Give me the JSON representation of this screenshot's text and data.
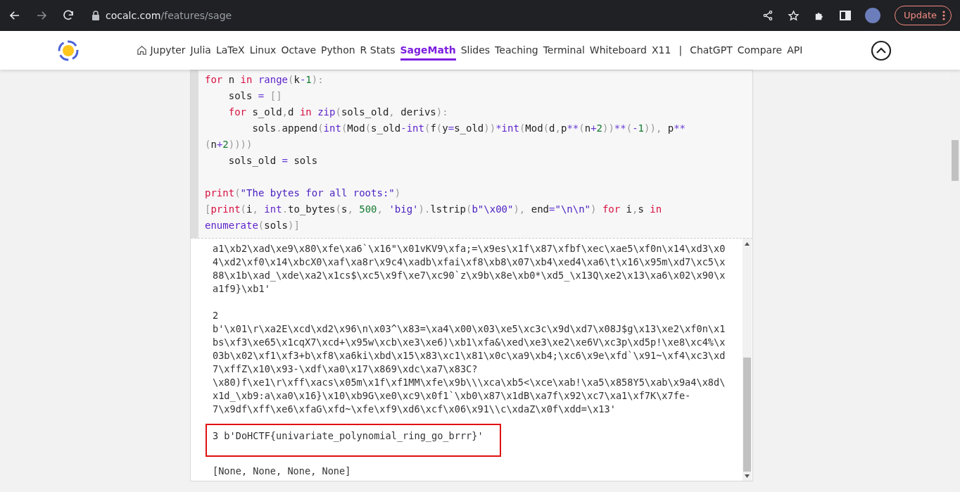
{
  "browser": {
    "url_host": "cocalc.com",
    "url_path": "/features/sage",
    "update_button": "Update"
  },
  "nav": {
    "items": [
      {
        "label": "Jupyter",
        "selected": false,
        "home_icon": true
      },
      {
        "label": "Julia",
        "selected": false
      },
      {
        "label": "LaTeX",
        "selected": false
      },
      {
        "label": "Linux",
        "selected": false
      },
      {
        "label": "Octave",
        "selected": false
      },
      {
        "label": "Python",
        "selected": false
      },
      {
        "label": "R Stats",
        "selected": false
      },
      {
        "label": "SageMath",
        "selected": true
      },
      {
        "label": "Slides",
        "selected": false
      },
      {
        "label": "Teaching",
        "selected": false
      },
      {
        "label": "Terminal",
        "selected": false
      },
      {
        "label": "Whiteboard",
        "selected": false
      },
      {
        "label": "X11",
        "selected": false
      },
      {
        "label": "|",
        "kind": "separator"
      },
      {
        "label": "ChatGPT",
        "selected": false
      },
      {
        "label": "Compare",
        "selected": false
      },
      {
        "label": "API",
        "selected": false
      }
    ]
  },
  "code": {
    "lines": [
      {
        "tokens": [
          {
            "text": "for",
            "kind": "kw"
          },
          {
            "text": " n ",
            "kind": "plain"
          },
          {
            "text": "in ",
            "kind": "kw"
          },
          {
            "text": "range",
            "kind": "builtin"
          },
          {
            "text": "(",
            "kind": "punct"
          },
          {
            "text": "k",
            "kind": "plain"
          },
          {
            "text": "-",
            "kind": "op"
          },
          {
            "text": "1",
            "kind": "num"
          },
          {
            "text": "):",
            "kind": "punct"
          }
        ]
      },
      {
        "tokens": [
          {
            "text": "    sols ",
            "kind": "plain"
          },
          {
            "text": "= ",
            "kind": "op"
          },
          {
            "text": "[]",
            "kind": "punct"
          }
        ]
      },
      {
        "tokens": [
          {
            "text": "    for",
            "kind": "kw"
          },
          {
            "text": " s_old",
            "kind": "plain"
          },
          {
            "text": ",",
            "kind": "punct"
          },
          {
            "text": "d ",
            "kind": "plain"
          },
          {
            "text": "in ",
            "kind": "kw"
          },
          {
            "text": "zip",
            "kind": "builtin"
          },
          {
            "text": "(",
            "kind": "punct"
          },
          {
            "text": "sols_old",
            "kind": "plain"
          },
          {
            "text": ",",
            "kind": "punct"
          },
          {
            "text": " derivs",
            "kind": "plain"
          },
          {
            "text": "):",
            "kind": "punct"
          }
        ]
      },
      {
        "tokens": [
          {
            "text": "        sols",
            "kind": "plain"
          },
          {
            "text": ".",
            "kind": "punct"
          },
          {
            "text": "append",
            "kind": "plain"
          },
          {
            "text": "(",
            "kind": "punct"
          },
          {
            "text": "int",
            "kind": "builtin"
          },
          {
            "text": "(",
            "kind": "punct"
          },
          {
            "text": "Mod",
            "kind": "plain"
          },
          {
            "text": "(",
            "kind": "punct"
          },
          {
            "text": "s_old",
            "kind": "plain"
          },
          {
            "text": "-",
            "kind": "op"
          },
          {
            "text": "int",
            "kind": "builtin"
          },
          {
            "text": "(",
            "kind": "punct"
          },
          {
            "text": "f",
            "kind": "plain"
          },
          {
            "text": "(",
            "kind": "punct"
          },
          {
            "text": "y",
            "kind": "plain"
          },
          {
            "text": "=",
            "kind": "op"
          },
          {
            "text": "s_old",
            "kind": "plain"
          },
          {
            "text": "))",
            "kind": "punct"
          },
          {
            "text": "*",
            "kind": "op"
          },
          {
            "text": "int",
            "kind": "builtin"
          },
          {
            "text": "(",
            "kind": "punct"
          },
          {
            "text": "Mod",
            "kind": "plain"
          },
          {
            "text": "(",
            "kind": "punct"
          },
          {
            "text": "d",
            "kind": "plain"
          },
          {
            "text": ",",
            "kind": "punct"
          },
          {
            "text": "p",
            "kind": "plain"
          },
          {
            "text": "**",
            "kind": "op"
          },
          {
            "text": "(",
            "kind": "punct"
          },
          {
            "text": "n",
            "kind": "plain"
          },
          {
            "text": "+",
            "kind": "op"
          },
          {
            "text": "2",
            "kind": "num"
          },
          {
            "text": "))",
            "kind": "punct"
          },
          {
            "text": "**",
            "kind": "op"
          },
          {
            "text": "(",
            "kind": "punct"
          },
          {
            "text": "-",
            "kind": "op"
          },
          {
            "text": "1",
            "kind": "num"
          },
          {
            "text": ")),",
            "kind": "punct"
          },
          {
            "text": " p",
            "kind": "plain"
          },
          {
            "text": "**",
            "kind": "op"
          }
        ]
      },
      {
        "tokens": [
          {
            "text": "(",
            "kind": "punct"
          },
          {
            "text": "n",
            "kind": "plain"
          },
          {
            "text": "+",
            "kind": "op"
          },
          {
            "text": "2",
            "kind": "num"
          },
          {
            "text": "))))",
            "kind": "punct"
          }
        ]
      },
      {
        "tokens": [
          {
            "text": "    sols_old ",
            "kind": "plain"
          },
          {
            "text": "=",
            "kind": "op"
          },
          {
            "text": " sols",
            "kind": "plain"
          }
        ]
      },
      {
        "blank_before": true,
        "tokens": [
          {
            "text": "print",
            "kind": "kw"
          },
          {
            "text": "(",
            "kind": "punct"
          },
          {
            "text": "\"The bytes for all roots:\"",
            "kind": "str"
          },
          {
            "text": ")",
            "kind": "punct"
          }
        ]
      },
      {
        "tokens": [
          {
            "text": "[",
            "kind": "punct"
          },
          {
            "text": "print",
            "kind": "kw"
          },
          {
            "text": "(",
            "kind": "punct"
          },
          {
            "text": "i",
            "kind": "plain"
          },
          {
            "text": ", ",
            "kind": "punct"
          },
          {
            "text": "int",
            "kind": "builtin"
          },
          {
            "text": ".",
            "kind": "punct"
          },
          {
            "text": "to_bytes",
            "kind": "plain"
          },
          {
            "text": "(",
            "kind": "punct"
          },
          {
            "text": "s",
            "kind": "plain"
          },
          {
            "text": ", ",
            "kind": "punct"
          },
          {
            "text": "500",
            "kind": "num"
          },
          {
            "text": ", ",
            "kind": "punct"
          },
          {
            "text": "'big'",
            "kind": "str"
          },
          {
            "text": ").",
            "kind": "punct"
          },
          {
            "text": "lstrip",
            "kind": "plain"
          },
          {
            "text": "(",
            "kind": "punct"
          },
          {
            "text": "b\"\\x00\"",
            "kind": "str"
          },
          {
            "text": "),",
            "kind": "punct"
          },
          {
            "text": " end",
            "kind": "plain"
          },
          {
            "text": "=",
            "kind": "op"
          },
          {
            "text": "\"\\n\\n\"",
            "kind": "str"
          },
          {
            "text": ") ",
            "kind": "punct"
          },
          {
            "text": "for",
            "kind": "kw"
          },
          {
            "text": " i",
            "kind": "plain"
          },
          {
            "text": ",",
            "kind": "punct"
          },
          {
            "text": "s ",
            "kind": "plain"
          },
          {
            "text": "in",
            "kind": "kw"
          }
        ]
      },
      {
        "tokens": [
          {
            "text": "enumerate",
            "kind": "builtin"
          },
          {
            "text": "(",
            "kind": "punct"
          },
          {
            "text": "sols",
            "kind": "plain"
          },
          {
            "text": ")]",
            "kind": "punct"
          }
        ]
      }
    ]
  },
  "output": {
    "blocks": [
      {
        "highlighted": false,
        "lines": [
          "a1\\xb2\\xad\\xe9\\x80\\xfe\\xa6`\\x16\"\\x01vKV9\\xfa;=\\x9es\\x1f\\x87\\xfbf\\xec\\xae5\\xf0n\\x14\\xd3\\x0",
          "4\\xd2\\xf0\\x14\\xbcX0\\xaf\\xa8r\\x9c4\\xadb\\xfai\\xf8\\xb8\\x07\\xb4\\xed4\\xa6\\t\\x16\\x95m\\xd7\\xc5\\x",
          "88\\x1b\\xad_\\xde\\xa2\\x1cs$\\xc5\\x9f\\xe7\\xc90`z\\x9b\\x8e\\xb0*\\xd5_\\x13Q\\xe2\\x13\\xa6\\x02\\x90\\x",
          "a1f9}\\xb1'"
        ]
      },
      {
        "highlighted": false,
        "lines": [
          "2",
          "b'\\x01\\r\\xa2E\\xcd\\xd2\\x96\\n\\x03^\\x83=\\xa4\\x00\\x03\\xe5\\xc3c\\x9d\\xd7\\x08J$g\\x13\\xe2\\xf0n\\x1",
          "bs\\xf3\\xe65\\x1cqX7\\xcd+\\x95w\\xcb\\xe3\\xe6)\\xb1\\xfa&\\xed\\xe3\\xe2\\xe6V\\xc3p\\xd5p!\\xe8\\xc4%\\x",
          "03b\\x02\\xf1\\xf3+b\\xf8\\xa6ki\\xbd\\x15\\x83\\xc1\\x81\\x0c\\xa9\\xb4;\\xc6\\x9e\\xfd`\\x91~\\xf4\\xc3\\xd",
          "7\\xffZ\\x10\\x93-\\xdf\\xa0\\x17\\x869\\xdc\\xa7\\x83C?",
          "\\x80)f\\xe1\\r\\xff\\xacs\\x05m\\x1f\\xf1MM\\xfe\\x9b\\\\\\xca\\xb5<\\xce\\xab!\\xa5\\x858Y5\\xab\\x9a4\\x8d\\",
          "x1d_\\xb9:a\\xa0\\x16}\\x10\\xb9G\\xe0\\xc9\\x0f1`\\xb0\\x87\\x1dB\\xa7f\\x92\\xc7\\xa1\\xf7K\\x7fe-",
          "7\\x9df\\xff\\xe6\\xfaG\\xfd~\\xfe\\xf9\\xd6\\xcf\\x06\\x91\\\\c\\xdaZ\\x0f\\xdd=\\x13'"
        ]
      },
      {
        "highlighted": true,
        "lines": [
          "3 b'DoHCTF{univariate_polynomial_ring_go_brrr}'"
        ]
      },
      {
        "highlighted": false,
        "lines": [
          "[None, None, None, None]"
        ]
      }
    ]
  }
}
